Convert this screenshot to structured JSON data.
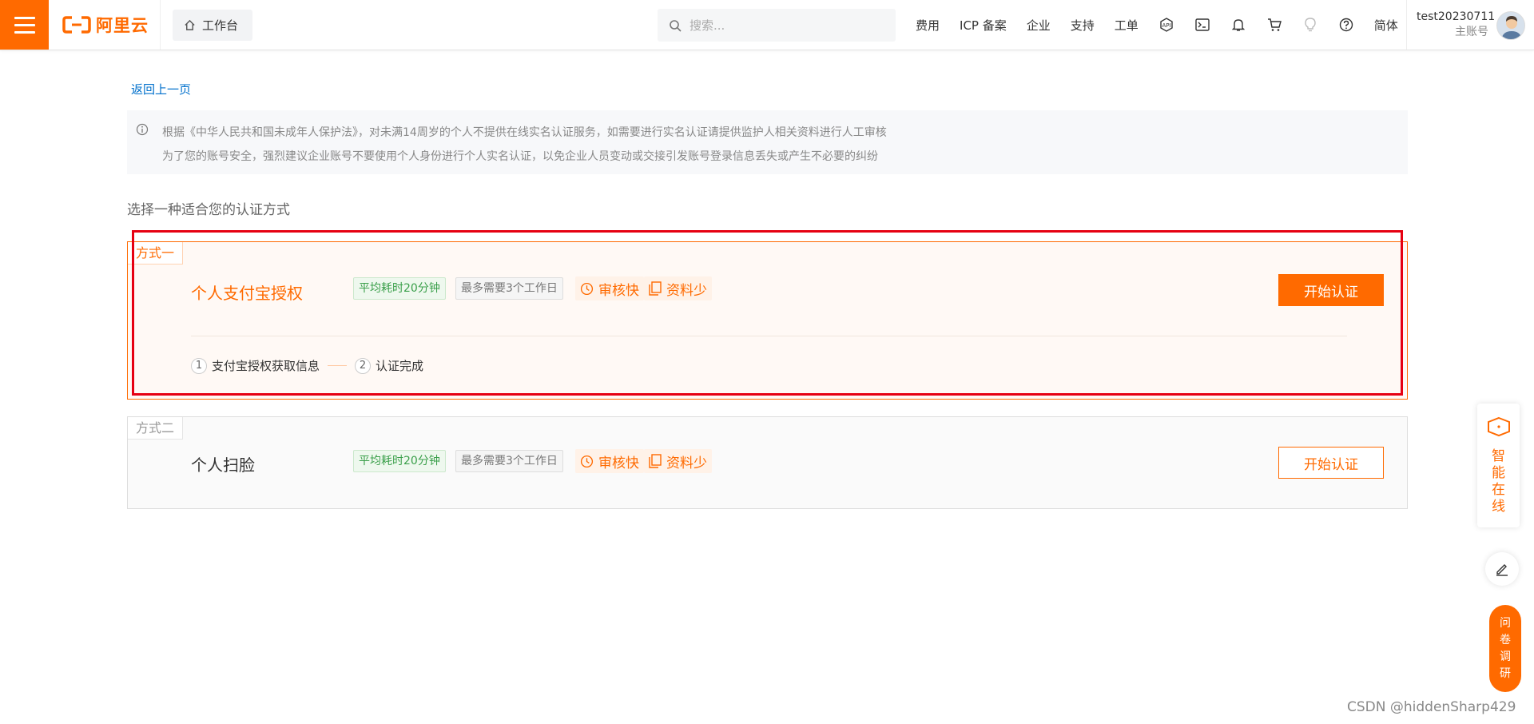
{
  "header": {
    "logo_text": "阿里云",
    "workbench_label": "工作台",
    "search_placeholder": "搜索...",
    "nav_links": [
      "费用",
      "ICP 备案",
      "企业",
      "支持",
      "工单"
    ],
    "lang": "简体",
    "user_name": "test20230711",
    "user_type": "主账号",
    "icons": [
      "api-icon",
      "terminal-icon",
      "bell-icon",
      "cart-icon",
      "lightbulb-icon",
      "help-icon"
    ]
  },
  "page": {
    "back_link": "返回上一页",
    "notice_line1": "根据《中华人民共和国未成年人保护法》，对未满14周岁的个人不提供在线实名认证服务，如需要进行实名认证请提供监护人相关资料进行人工审核",
    "notice_line2": "为了您的账号安全，强烈建议企业账号不要使用个人身份进行个人实名认证，以免企业人员变动或交接引发账号登录信息丢失或产生不必要的纠纷",
    "section_title": "选择一种适合您的认证方式"
  },
  "methods": [
    {
      "tag": "方式一",
      "title": "个人支付宝授权",
      "badge_time": "平均耗时20分钟",
      "badge_days": "最多需要3个工作日",
      "feature_fast": "审核快",
      "feature_docs": "资料少",
      "button": "开始认证",
      "steps": [
        {
          "num": "1",
          "label": "支付宝授权获取信息"
        },
        {
          "num": "2",
          "label": "认证完成"
        }
      ]
    },
    {
      "tag": "方式二",
      "title": "个人扫脸",
      "badge_time": "平均耗时20分钟",
      "badge_days": "最多需要3个工作日",
      "feature_fast": "审核快",
      "feature_docs": "资料少",
      "button": "开始认证"
    }
  ],
  "floating": {
    "assistant": "智能在线",
    "survey": "问卷调研"
  },
  "watermark": "CSDN @hiddenSharp429",
  "colors": {
    "brand": "#ff6a00",
    "link": "#0070cc",
    "highlight_box": "#e60012",
    "badge_green": "#3a9f4a"
  }
}
